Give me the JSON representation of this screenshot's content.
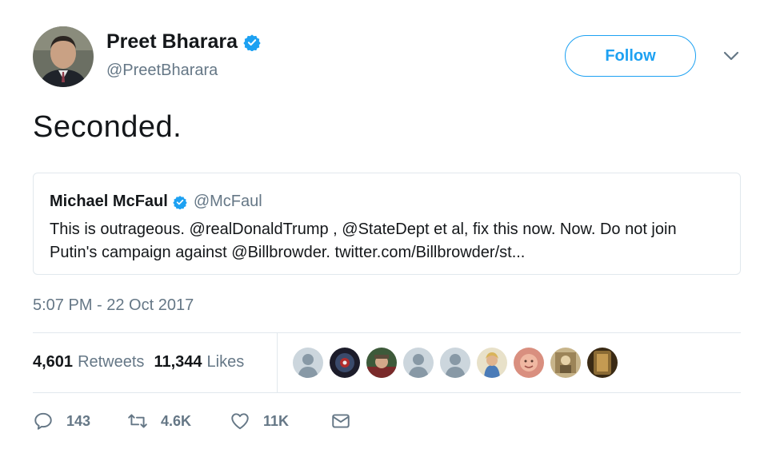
{
  "author": {
    "display_name": "Preet Bharara",
    "handle": "@PreetBharara"
  },
  "follow_label": "Follow",
  "tweet_text": "Seconded.",
  "quoted": {
    "display_name": "Michael McFaul",
    "handle": "@McFaul",
    "text": "This is outrageous. @realDonaldTrump , @StateDept et al, fix this now. Now. Do not join Putin's campaign against @Billbrowder. twitter.com/Billbrowder/st..."
  },
  "timestamp": "5:07 PM - 22 Oct 2017",
  "stats": {
    "retweets_count": "4,601",
    "retweets_label": "Retweets",
    "likes_count": "11,344",
    "likes_label": "Likes"
  },
  "actions": {
    "replies": "143",
    "retweets": "4.6K",
    "likes": "11K"
  },
  "colors": {
    "accent": "#1da1f2",
    "secondary_text": "#657786",
    "border": "#e1e8ed"
  }
}
